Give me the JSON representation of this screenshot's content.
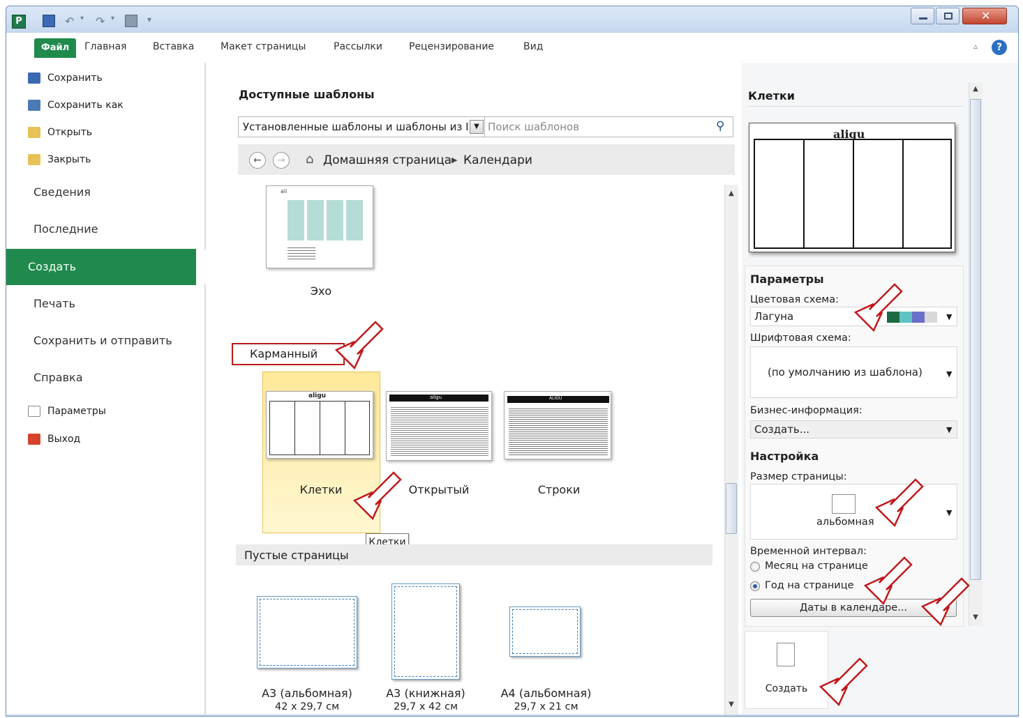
{
  "window": {
    "app_icon_letter": "P"
  },
  "tabs": {
    "file": "Файл",
    "home": "Главная",
    "insert": "Вставка",
    "layout": "Макет страницы",
    "mailings": "Рассылки",
    "review": "Рецензирование",
    "view": "Вид"
  },
  "nav": {
    "save": "Сохранить",
    "save_as": "Сохранить как",
    "open": "Открыть",
    "close": "Закрыть",
    "info": "Сведения",
    "recent": "Последние",
    "create": "Создать",
    "print": "Печать",
    "save_send": "Сохранить и отправить",
    "help": "Справка",
    "options": "Параметры",
    "exit": "Выход"
  },
  "middle": {
    "title": "Доступные шаблоны",
    "combo_value": "Установленные шаблоны и шаблоны из I",
    "search_placeholder": "Поиск шаблонов",
    "breadcrumb_home": "Домашняя страница",
    "breadcrumb_current": "Календари",
    "echo_label": "Эхо",
    "echo_thumb_text": "ali",
    "pocket_header": "Карманный",
    "templates": [
      {
        "label": "Клетки",
        "thumb_title": "aligu"
      },
      {
        "label": "Открытый",
        "thumb_title": "aligu"
      },
      {
        "label": "Строки",
        "thumb_title": "ALIGU"
      }
    ],
    "tooltip": "Клетки",
    "blank_header": "Пустые страницы",
    "blank_pages": [
      {
        "name": "А3 (альбомная)",
        "size": "42 x 29,7 см"
      },
      {
        "name": "А3 (книжная)",
        "size": "29,7 x 42 см"
      },
      {
        "name": "А4 (альбомная)",
        "size": "29,7 x 21 см"
      }
    ]
  },
  "right": {
    "title": "Клетки",
    "preview_title": "aligu",
    "params_title": "Параметры",
    "color_scheme_label": "Цветовая схема:",
    "color_scheme_value": "Лагуна",
    "color_swatches": [
      "#1a6b45",
      "#5fc3c1",
      "#6b6fc9",
      "#d9d9d9"
    ],
    "font_scheme_label": "Шрифтовая схема:",
    "font_scheme_value": "(по умолчанию из шаблона)",
    "business_label": "Бизнес-информация:",
    "business_value": "Создать...",
    "setup_title": "Настройка",
    "page_size_label": "Размер страницы:",
    "page_size_value": "альбомная",
    "interval_label": "Временной интервал:",
    "radio_month": "Месяц на странице",
    "radio_year": "Год на странице",
    "dates_button": "Даты в календаре...",
    "create_button": "Создать"
  },
  "colors": {
    "accent": "#1f8a4c",
    "annotation_red": "#c0181b",
    "selection": "#ffe99a"
  }
}
